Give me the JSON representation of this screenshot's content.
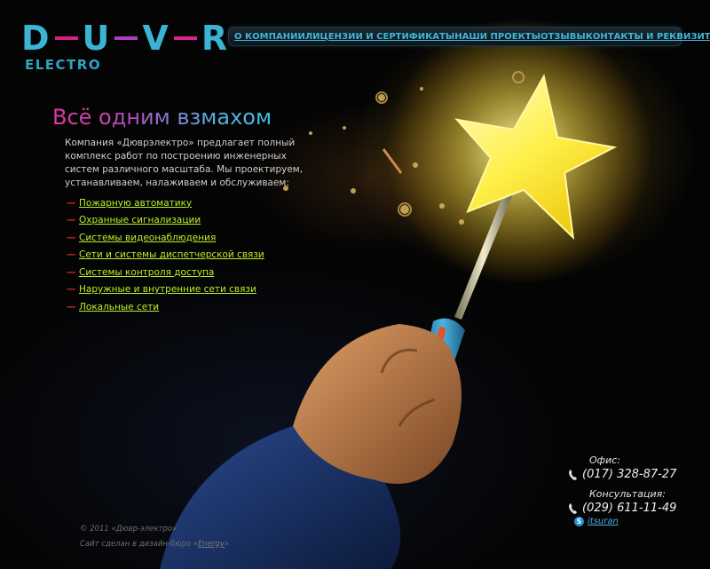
{
  "logo": {
    "letters": [
      "D",
      "U",
      "V",
      "R"
    ],
    "dash_colors": [
      "#d6207d",
      "#a83fbf",
      "#e0208c"
    ],
    "subtitle": "ELECTRO",
    "color": "#3bb3d4"
  },
  "nav": {
    "items": [
      {
        "label": "О КОМПАНИИ"
      },
      {
        "label": "ЛИЦЕНЗИИ И СЕРТИФИКАТЫ"
      },
      {
        "label": "НАШИ ПРОЕКТЫ"
      },
      {
        "label": "ОТЗЫВЫ"
      },
      {
        "label": "КОНТАКТЫ И РЕКВИЗИТЫ"
      }
    ],
    "accent": "#3fb6d8"
  },
  "hero": {
    "headline": "Всё одним взмахом",
    "intro": "Компания «Дюврэлектро» предлагает полный комплекс работ по построению инженерных систем различного масштаба. Мы проектируем, устанавливаем, налаживаем и обслуживаем:",
    "services": [
      {
        "label": "Пожарную автоматику"
      },
      {
        "label": "Охранные сигнализации"
      },
      {
        "label": "Системы видеонаблюдения"
      },
      {
        "label": "Сети и системы диспетчерской связи"
      },
      {
        "label": "Системы контроля доступа"
      },
      {
        "label": "Наружные и внутренние сети связи"
      },
      {
        "label": "Локальные сети"
      }
    ],
    "link_color": "#bff02a",
    "bullet_color": "#d11e2e",
    "illustration": "hand-holding-screwdriver-star-wand"
  },
  "contacts": {
    "office_label": "Офис:",
    "office_phone": "(017) 328-87-27",
    "consult_label": "Консультация:",
    "consult_phone": "(029) 611-11-49",
    "skype": "itsuran",
    "phone_icon": "phone-icon",
    "skype_icon": "skype-icon"
  },
  "footer": {
    "copyright": "© 2011 «Дювр-электро»",
    "credit_prefix": "Сайт сделан в дизайн-бюро «",
    "credit_link": "Energy",
    "credit_suffix": "»"
  }
}
